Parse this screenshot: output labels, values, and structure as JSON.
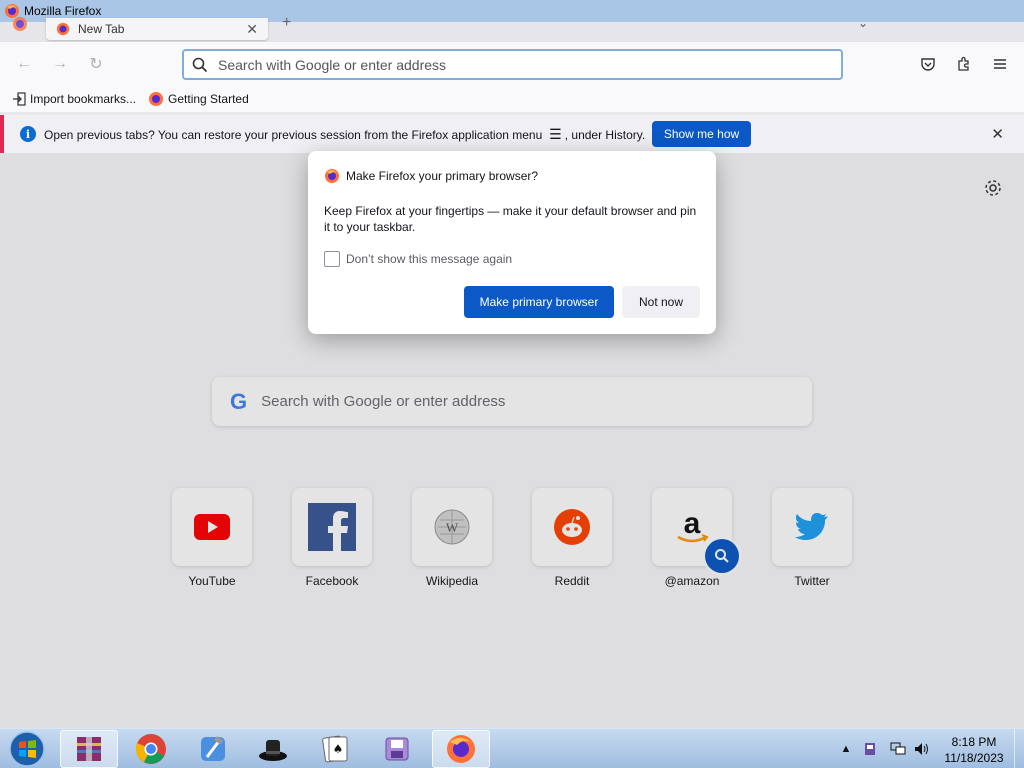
{
  "window": {
    "title": "Mozilla Firefox"
  },
  "tabs": [
    {
      "label": "New Tab"
    }
  ],
  "urlbar": {
    "placeholder": "Search with Google or enter address"
  },
  "bookmarks": [
    {
      "label": "Import bookmarks...",
      "icon": "import-icon"
    },
    {
      "label": "Getting Started",
      "icon": "firefox-icon"
    }
  ],
  "notification": {
    "text": "Open previous tabs? You can restore your previous session from the Firefox application menu",
    "text_after": ", under History.",
    "button": "Show me how"
  },
  "content": {
    "search_placeholder": "Search with Google or enter address",
    "search_logo": "G",
    "tiles": [
      {
        "label": "YouTube",
        "icon": "youtube-icon"
      },
      {
        "label": "Facebook",
        "icon": "facebook-icon"
      },
      {
        "label": "Wikipedia",
        "icon": "wikipedia-icon"
      },
      {
        "label": "Reddit",
        "icon": "reddit-icon"
      },
      {
        "label": "@amazon",
        "icon": "amazon-icon"
      },
      {
        "label": "Twitter",
        "icon": "twitter-icon"
      }
    ]
  },
  "dialog": {
    "title": "Make Firefox your primary browser?",
    "body": "Keep Firefox at your fingertips — make it your default browser and pin it to your taskbar.",
    "checkbox_label": "Don’t show this message again",
    "primary_button": "Make primary browser",
    "secondary_button": "Not now"
  },
  "taskbar": {
    "apps": [
      "winrar-icon",
      "chrome-icon",
      "xcode-icon",
      "hat-icon",
      "solitaire-icon",
      "floppy-icon",
      "firefox-icon"
    ],
    "time": "8:18 PM",
    "date": "11/18/2023"
  },
  "colors": {
    "accent": "#0b59c6",
    "notification_border": "#e22850",
    "urlbar_focus": "#7eaed9"
  }
}
